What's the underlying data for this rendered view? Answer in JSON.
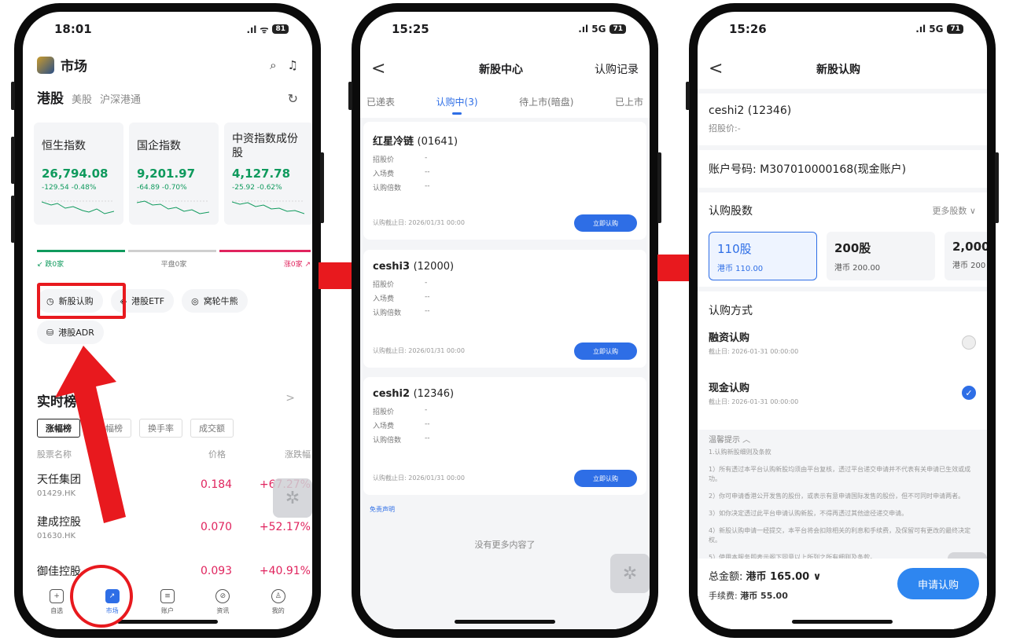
{
  "phone1": {
    "time": "18:01",
    "signal": ".ıl ᯤ",
    "battery": "81",
    "title": "市场",
    "market_tabs": [
      "港股",
      "美股",
      "沪深港通"
    ],
    "indices": [
      {
        "name": "恒生指数",
        "value": "26,794.08",
        "change": "-129.54 -0.48%"
      },
      {
        "name": "国企指数",
        "value": "9,201.97",
        "change": "-64.89 -0.70%"
      },
      {
        "name": "中资指数成份股",
        "value": "4,127.78",
        "change": "-25.92 -0.62%"
      }
    ],
    "distribution": {
      "down": "跌0家",
      "flat": "平盘0家",
      "up": "涨0家"
    },
    "shortcuts": [
      "新股认购",
      "港股ETF",
      "窝轮牛熊",
      "港股ADR"
    ],
    "ranking_title": "实时榜",
    "ranking_more": ">",
    "ranking_tabs": [
      "涨幅榜",
      "跌幅榜",
      "换手率",
      "成交额"
    ],
    "ranking_header": {
      "name": "股票名称",
      "price": "价格",
      "change": "涨跌幅"
    },
    "stocks": [
      {
        "name": "天任集团",
        "code": "01429.HK",
        "price": "0.184",
        "change": "+67.27%"
      },
      {
        "name": "建成控股",
        "code": "01630.HK",
        "price": "0.070",
        "change": "+52.17%"
      },
      {
        "name": "御佳控股",
        "code": "",
        "price": "0.093",
        "change": "+40.91%"
      }
    ],
    "tabbar": [
      "自选",
      "市场",
      "账户",
      "资讯",
      "我的"
    ]
  },
  "phone2": {
    "time": "15:25",
    "signal": ".ıl 5G",
    "battery": "71",
    "back": "<",
    "title": "新股中心",
    "right_action": "认购记录",
    "tabs": [
      "已递表",
      "认购中(3)",
      "待上市(暗盘)",
      "已上市"
    ],
    "field_labels": [
      "招股价",
      "入场费",
      "认购倍数"
    ],
    "ipos": [
      {
        "name": "红星冷链",
        "code": "(01641)",
        "values": [
          "-",
          "--",
          "--"
        ],
        "deadline": "认购截止日: 2026/01/31 00:00",
        "button": "立即认购"
      },
      {
        "name": "ceshi3",
        "code": "(12000)",
        "values": [
          "-",
          "--",
          "--"
        ],
        "deadline": "认购截止日: 2026/01/31 00:00",
        "button": "立即认购"
      },
      {
        "name": "ceshi2",
        "code": "(12346)",
        "values": [
          "-",
          "--",
          "--"
        ],
        "deadline": "认购截止日: 2026/01/31 00:00",
        "button": "立即认购"
      }
    ],
    "disclaimer": "免责声明",
    "no_more": "没有更多内容了"
  },
  "phone3": {
    "time": "15:26",
    "signal": ".ıl 5G",
    "battery": "71",
    "back": "<",
    "title": "新股认购",
    "stock": "ceshi2 (12346)",
    "offer_price": "招股价:-",
    "account": "账户号码: M307010000168(现金账户)",
    "shares_label": "认购股数",
    "more_shares": "更多股数 ∨",
    "share_options": [
      {
        "qty": "110股",
        "price": "港币 110.00"
      },
      {
        "qty": "200股",
        "price": "港币 200.00"
      },
      {
        "qty": "2,000",
        "price": "港币 200"
      }
    ],
    "method_label": "认购方式",
    "methods": [
      {
        "name": "融资认购",
        "deadline": "截止日: 2026-01-31 00:00:00",
        "selected": false
      },
      {
        "name": "现金认购",
        "deadline": "截止日: 2026-01-31 00:00:00",
        "selected": true
      }
    ],
    "tips_title": "温馨提示 ︿",
    "tips_subtitle": "1.认购新股细则及条款",
    "tips": [
      "1）所有透过本平台认购新股均须由平台复核，透过平台递交申请并不代表有关申请已生效或成功。",
      "2）你可申请香港公开发售的股份，或表示有意申请国际发售的股份，但不可同时申请两者。",
      "3）如你决定透过此平台申请认购新股，不得再透过其他途径递交申请。",
      "4）新股认购申请一经提交，本平台将会扣除相关的利息和手续费，及保留可有更改的最终决定权。",
      "5）使用本服务即表示阁下同意以上所列之所有细则及条款。"
    ],
    "total_label": "总金额:",
    "total_value": "港币 165.00 ∨",
    "fee_label": "手续费:",
    "fee_value": "港币 55.00",
    "submit": "申请认购"
  },
  "colors": {
    "accent": "#2e6ee6",
    "highlight": "#e8191e",
    "up": "#e0245e",
    "down": "#0f9a5d"
  }
}
